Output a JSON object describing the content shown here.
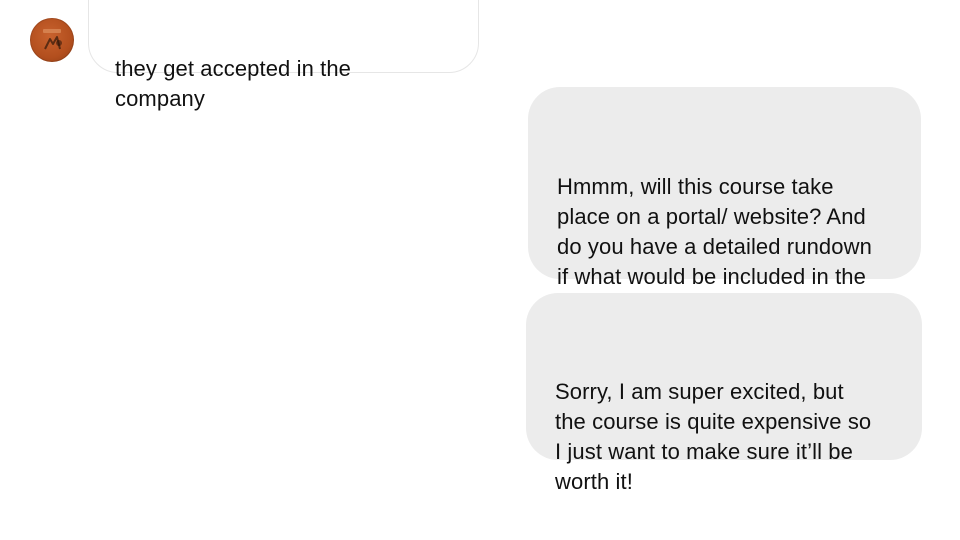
{
  "conversation": {
    "contact": {
      "avatar_icon": "contact-avatar-logo",
      "avatar_color": "#b34f1e"
    },
    "messages": [
      {
        "direction": "incoming",
        "text": "they get accepted in the\ncompany"
      },
      {
        "direction": "outgoing",
        "text": "Hmmm, will this course take\nplace on a portal/ website? And\ndo you have a detailed rundown\nif what would be included in the\ncourse?"
      },
      {
        "direction": "outgoing",
        "text": "Sorry, I am super excited, but\nthe course is quite expensive so\nI just want to make sure it’ll be\nworth it!"
      }
    ],
    "colors": {
      "outgoing_bubble": "#ececec",
      "incoming_bubble": "#ffffff",
      "incoming_border": "#e6e6e6",
      "text": "#111111"
    }
  }
}
